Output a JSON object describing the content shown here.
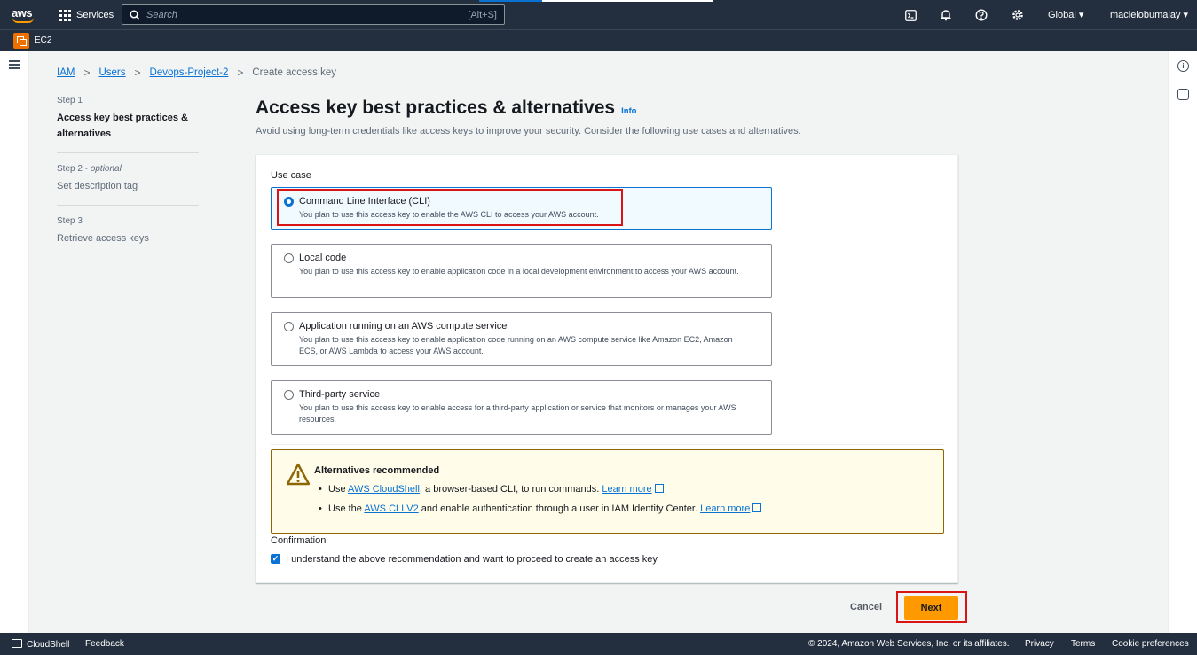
{
  "topnav": {
    "logo_text": "aws",
    "services_label": "Services",
    "search_placeholder": "Search",
    "search_shortcut": "[Alt+S]",
    "region": "Global ▾",
    "account": "macielobumalay ▾"
  },
  "subnav": {
    "service": "EC2"
  },
  "breadcrumb": {
    "items": [
      "IAM",
      "Users",
      "Devops-Project-2"
    ],
    "current": "Create access key"
  },
  "steps": [
    {
      "num": "Step 1",
      "optional": "",
      "title": "Access key best practices & alternatives"
    },
    {
      "num": "Step 2",
      "optional": "optional",
      "title": "Set description tag"
    },
    {
      "num": "Step 3",
      "optional": "",
      "title": "Retrieve access keys"
    }
  ],
  "main": {
    "title": "Access key best practices & alternatives",
    "info": "Info",
    "description": "Avoid using long-term credentials like access keys to improve your security. Consider the following use cases and alternatives.",
    "use_case_label": "Use case",
    "options": [
      {
        "title": "Command Line Interface (CLI)",
        "desc": "You plan to use this access key to enable the AWS CLI to access your AWS account."
      },
      {
        "title": "Local code",
        "desc": "You plan to use this access key to enable application code in a local development environment to access your AWS account."
      },
      {
        "title": "Application running on an AWS compute service",
        "desc": "You plan to use this access key to enable application code running on an AWS compute service like Amazon EC2, Amazon ECS, or AWS Lambda to access your AWS account."
      },
      {
        "title": "Third-party service",
        "desc": "You plan to use this access key to enable access for a third-party application or service that monitors or manages your AWS resources."
      }
    ],
    "alert": {
      "title": "Alternatives recommended",
      "li1_pre": "Use ",
      "li1_link": "AWS CloudShell",
      "li1_post": ", a browser-based CLI, to run commands. ",
      "li2_pre": "Use the ",
      "li2_link": "AWS CLI V2",
      "li2_post": " and enable authentication through a user in IAM Identity Center. ",
      "learn_more": "Learn more"
    },
    "confirmation_label": "Confirmation",
    "confirmation_text": "I understand the above recommendation and want to proceed to create an access key.",
    "checkbox_mark": "✓"
  },
  "actions": {
    "cancel": "Cancel",
    "next": "Next"
  },
  "footer": {
    "cloudshell": "CloudShell",
    "feedback": "Feedback",
    "copyright": "© 2024, Amazon Web Services, Inc. or its affiliates.",
    "privacy": "Privacy",
    "terms": "Terms",
    "cookies": "Cookie preferences"
  },
  "colors": {
    "accent": "#0972d3",
    "brand_orange": "#ff9900",
    "nav_bg": "#232f3e",
    "highlight": "#d91515"
  }
}
